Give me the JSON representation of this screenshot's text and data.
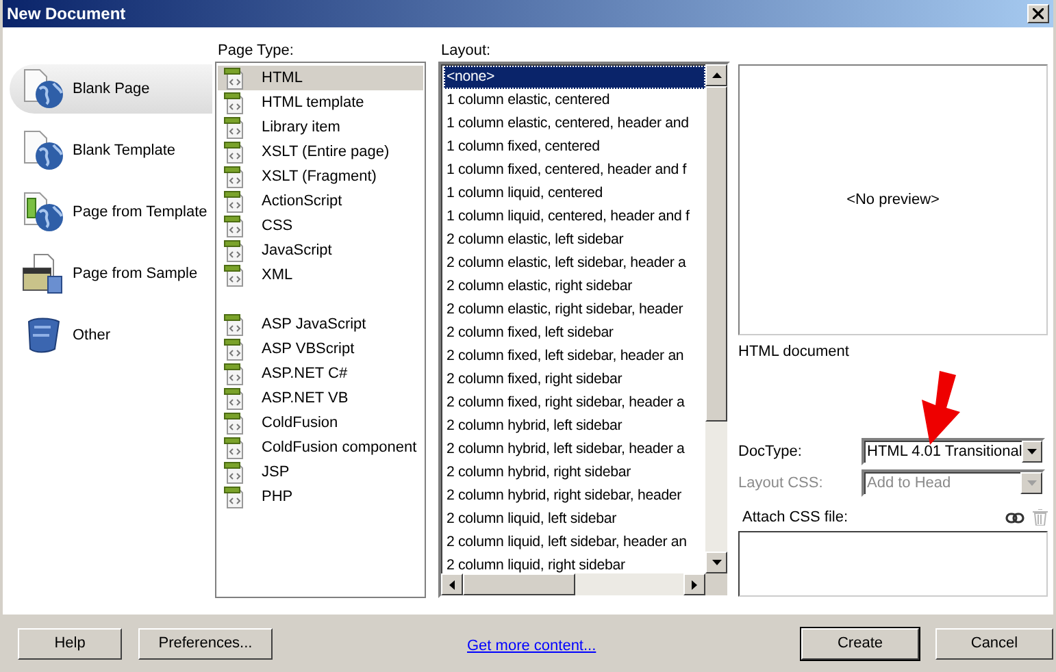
{
  "window": {
    "title": "New Document"
  },
  "categories": [
    {
      "label": "Blank Page",
      "selected": true
    },
    {
      "label": "Blank Template",
      "selected": false
    },
    {
      "label": "Page from Template",
      "selected": false
    },
    {
      "label": "Page from Sample",
      "selected": false
    },
    {
      "label": "Other",
      "selected": false
    }
  ],
  "page_type": {
    "label": "Page Type:",
    "groups": [
      {
        "items": [
          {
            "label": "HTML",
            "selected": true
          },
          {
            "label": "HTML template",
            "selected": false
          },
          {
            "label": "Library item",
            "selected": false
          },
          {
            "label": "XSLT (Entire page)",
            "selected": false
          },
          {
            "label": "XSLT (Fragment)",
            "selected": false
          },
          {
            "label": "ActionScript",
            "selected": false
          },
          {
            "label": "CSS",
            "selected": false
          },
          {
            "label": "JavaScript",
            "selected": false
          },
          {
            "label": "XML",
            "selected": false
          }
        ]
      },
      {
        "items": [
          {
            "label": "ASP JavaScript",
            "selected": false
          },
          {
            "label": "ASP VBScript",
            "selected": false
          },
          {
            "label": "ASP.NET C#",
            "selected": false
          },
          {
            "label": "ASP.NET VB",
            "selected": false
          },
          {
            "label": "ColdFusion",
            "selected": false
          },
          {
            "label": "ColdFusion component",
            "selected": false
          },
          {
            "label": "JSP",
            "selected": false
          },
          {
            "label": "PHP",
            "selected": false
          }
        ]
      }
    ]
  },
  "layout": {
    "label": "Layout:",
    "items": [
      {
        "label": "<none>",
        "selected": true
      },
      {
        "label": "1 column elastic, centered",
        "selected": false
      },
      {
        "label": "1 column elastic, centered, header and",
        "selected": false
      },
      {
        "label": "1 column fixed, centered",
        "selected": false
      },
      {
        "label": "1 column fixed, centered, header and f",
        "selected": false
      },
      {
        "label": "1 column liquid, centered",
        "selected": false
      },
      {
        "label": "1 column liquid, centered, header and f",
        "selected": false
      },
      {
        "label": "2 column elastic, left sidebar",
        "selected": false
      },
      {
        "label": "2 column elastic, left sidebar, header a",
        "selected": false
      },
      {
        "label": "2 column elastic, right sidebar",
        "selected": false
      },
      {
        "label": "2 column elastic, right sidebar, header",
        "selected": false
      },
      {
        "label": "2 column fixed, left sidebar",
        "selected": false
      },
      {
        "label": "2 column fixed, left sidebar, header an",
        "selected": false
      },
      {
        "label": "2 column fixed, right sidebar",
        "selected": false
      },
      {
        "label": "2 column fixed, right sidebar, header a",
        "selected": false
      },
      {
        "label": "2 column hybrid, left sidebar",
        "selected": false
      },
      {
        "label": "2 column hybrid, left sidebar, header a",
        "selected": false
      },
      {
        "label": "2 column hybrid, right sidebar",
        "selected": false
      },
      {
        "label": "2 column hybrid, right sidebar, header",
        "selected": false
      },
      {
        "label": "2 column liquid, left sidebar",
        "selected": false
      },
      {
        "label": "2 column liquid, left sidebar, header an",
        "selected": false
      },
      {
        "label": "2 column liquid, right sidebar",
        "selected": false
      }
    ]
  },
  "preview": {
    "text": "<No preview>",
    "description": "HTML document"
  },
  "fields": [
    {
      "label": "DocType:",
      "value": "HTML 4.01 Transitional",
      "disabled": false
    },
    {
      "label": "Layout CSS:",
      "value": "Add to Head",
      "disabled": true
    }
  ],
  "attach_css": {
    "label": "Attach CSS file:"
  },
  "footer": {
    "left_buttons": [
      "Help",
      "Preferences..."
    ],
    "link": "Get more content...",
    "right_buttons": [
      {
        "label": "Create",
        "default": true
      },
      {
        "label": "Cancel",
        "default": false
      }
    ]
  }
}
